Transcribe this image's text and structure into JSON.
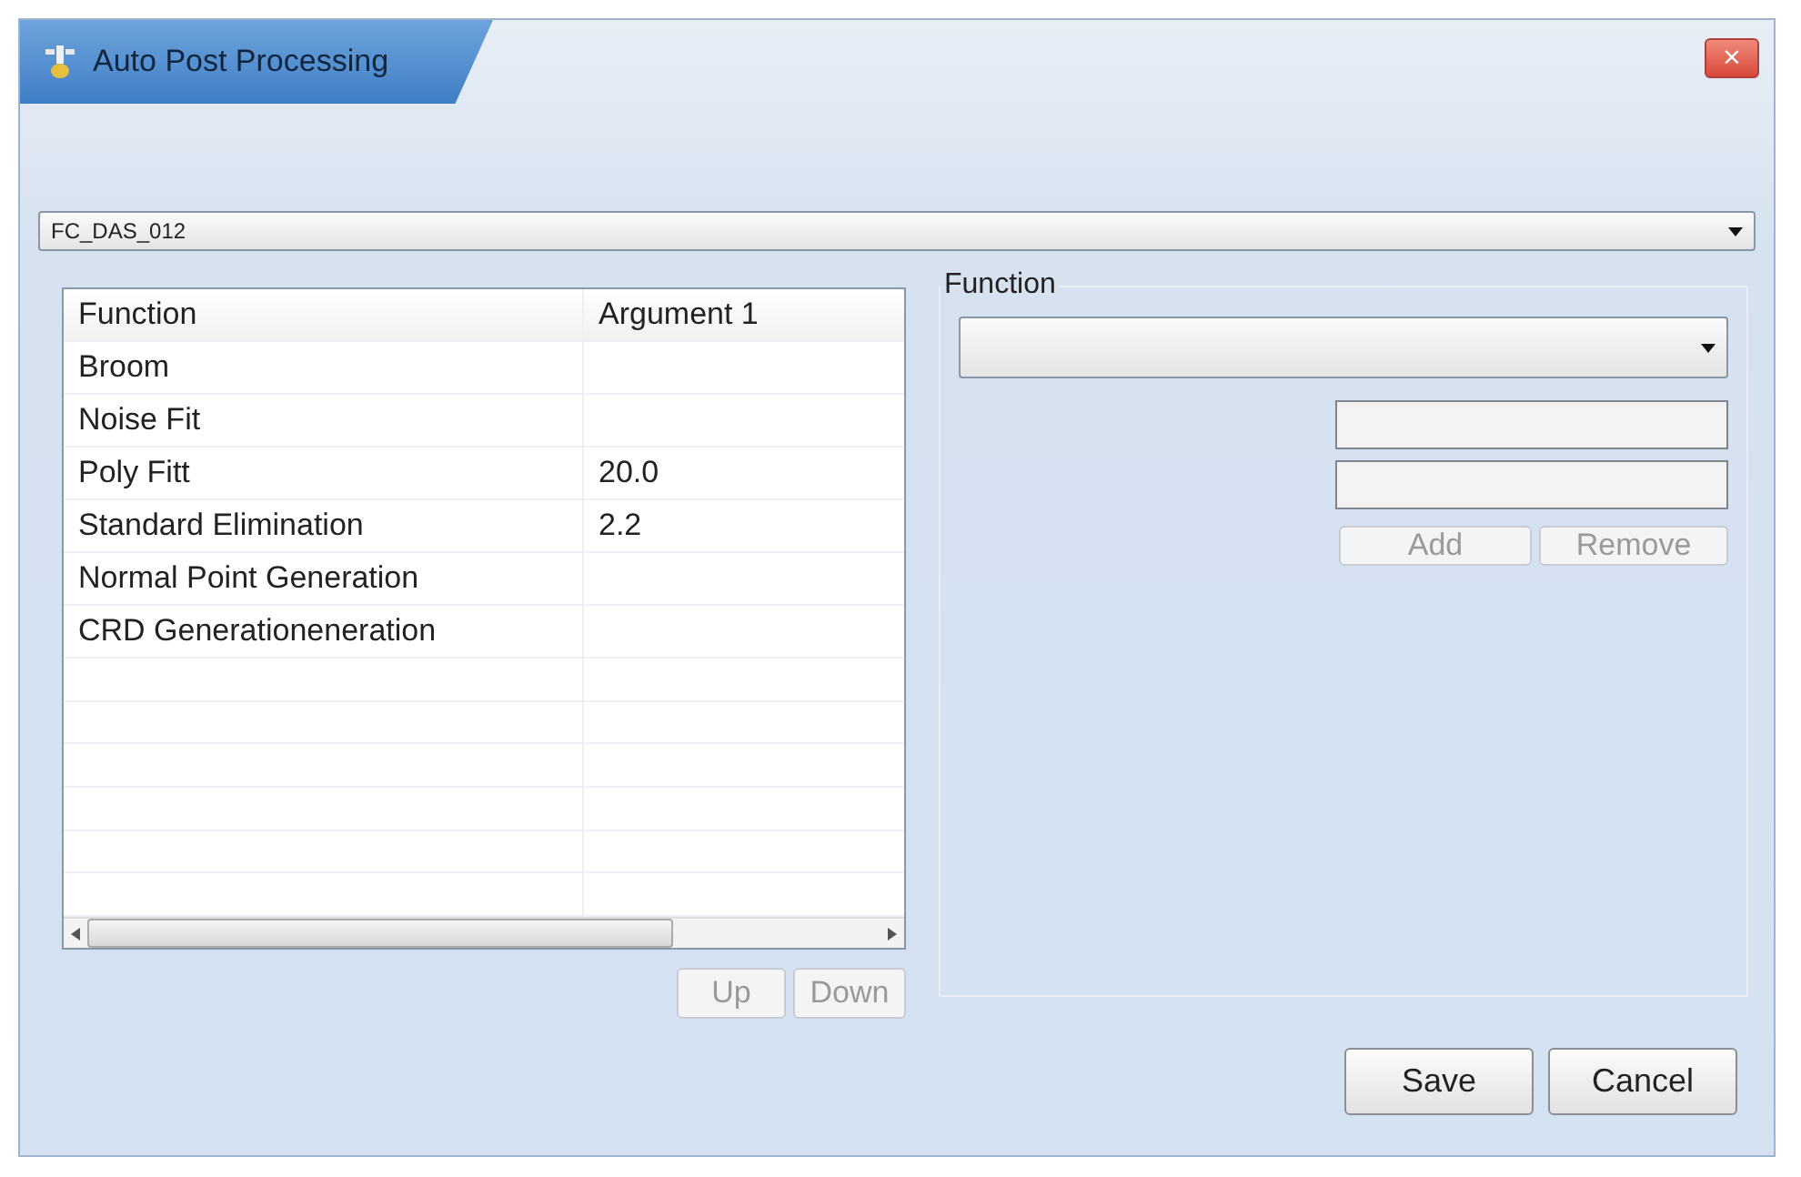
{
  "window": {
    "title": "Auto Post Processing",
    "close": "×"
  },
  "profile_select": {
    "value": "FC_DAS_012"
  },
  "function_table": {
    "columns": [
      "Function",
      "Argument 1"
    ],
    "rows": [
      [
        "Broom",
        ""
      ],
      [
        "Noise Fit",
        ""
      ],
      [
        "Poly Fitt",
        "20.0"
      ],
      [
        "Standard Elimination",
        "2.2"
      ],
      [
        "Normal Point Generation",
        ""
      ],
      [
        "CRD Generationeneration",
        ""
      ]
    ],
    "buttons": [
      {
        "label": "Up",
        "disabled": true
      },
      {
        "label": "Down",
        "disabled": true
      }
    ]
  },
  "function_group": {
    "legend": "Function",
    "buttons": [
      {
        "label": "Add",
        "disabled": true
      },
      {
        "label": "Remove",
        "disabled": true
      }
    ]
  },
  "footer_buttons": [
    {
      "label": "Save",
      "disabled": false
    },
    {
      "label": "Cancel",
      "disabled": false
    }
  ]
}
